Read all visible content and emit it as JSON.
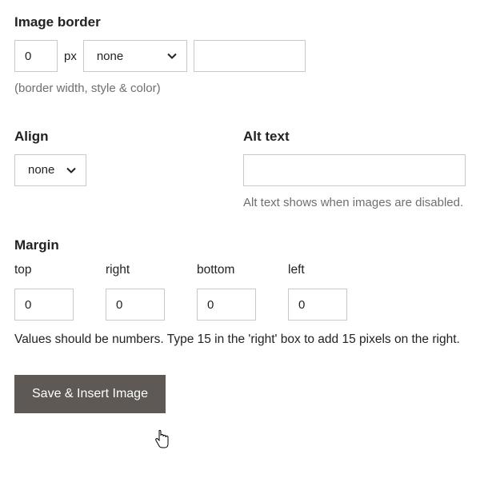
{
  "border": {
    "heading": "Image border",
    "width_value": "0",
    "unit": "px",
    "style_value": "none",
    "color_value": "",
    "help": "(border width, style & color)"
  },
  "align": {
    "heading": "Align",
    "value": "none"
  },
  "alt": {
    "heading": "Alt text",
    "value": "",
    "help": "Alt text shows when images are disabled."
  },
  "margin": {
    "heading": "Margin",
    "labels": {
      "top": "top",
      "right": "right",
      "bottom": "bottom",
      "left": "left"
    },
    "values": {
      "top": "0",
      "right": "0",
      "bottom": "0",
      "left": "0"
    },
    "help": "Values should be numbers. Type 15 in the 'right' box to add 15 pixels on the right."
  },
  "buttons": {
    "save": "Save & Insert Image"
  }
}
